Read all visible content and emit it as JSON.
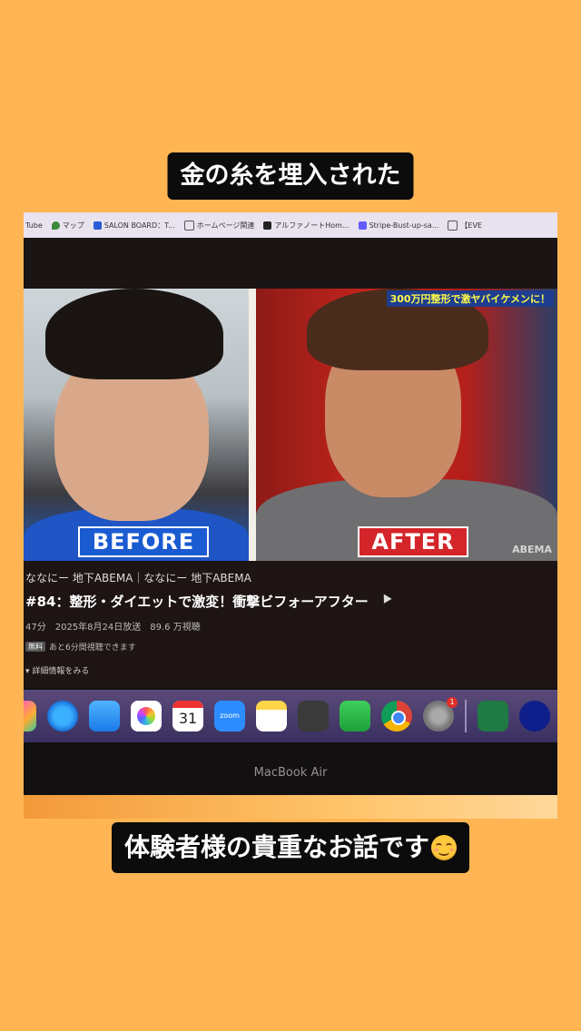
{
  "captions": {
    "top": "金の糸を埋入された",
    "bottom": "体験者様の貴重なお話です"
  },
  "bookmarks": [
    {
      "label": "Tube",
      "icon": "youtube-icon"
    },
    {
      "label": "マップ",
      "icon": "map-pin-icon"
    },
    {
      "label": "SALON BOARD：T...",
      "icon": "salon-board-icon"
    },
    {
      "label": "ホームページ関連",
      "icon": "folder-icon"
    },
    {
      "label": "アルファノートHom...",
      "icon": "notion-icon"
    },
    {
      "label": "Stripe-Bust-up-sa...",
      "icon": "stripe-icon"
    },
    {
      "label": "【EVE",
      "icon": "folder-icon"
    }
  ],
  "video": {
    "before_label": "BEFORE",
    "after_label": "AFTER",
    "banner": "300万円整形で激ヤバイケメンに！",
    "watermark": "ABEMA"
  },
  "info": {
    "channel": "ななにー 地下ABEMA｜ななにー 地下ABEMA",
    "title": "#84：整形・ダイエットで激変！衝撃ビフォーアフター",
    "meta": "47分　2025年8月24日放送　89.6 万視聴",
    "free_tag": "無料",
    "free_text": "あと6分間視聴できます",
    "details": "▾ 詳細情報をみる"
  },
  "dock": {
    "calendar_day": "31",
    "zoom_label": "zoom",
    "settings_badge": "1",
    "apps": [
      "photos-icon",
      "safari-icon",
      "mail-icon",
      "photos-app-icon",
      "calendar-icon",
      "zoom-icon",
      "notes-icon",
      "calculator-icon",
      "numbers-icon",
      "chrome-icon",
      "settings-icon",
      "excel-icon",
      "teamviewer-icon"
    ]
  },
  "device_label": "MacBook Air",
  "colors": {
    "background": "#FFB553",
    "before_blue": "#1a5bd1",
    "after_red": "#d4252a"
  }
}
